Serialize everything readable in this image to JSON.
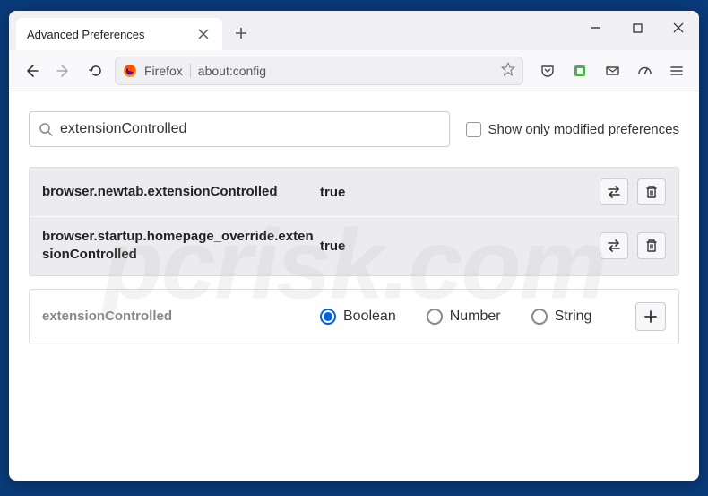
{
  "window": {
    "tab_title": "Advanced Preferences"
  },
  "toolbar": {
    "brand": "Firefox",
    "address": "about:config"
  },
  "search": {
    "value": "extensionControlled",
    "checkbox_label": "Show only modified preferences"
  },
  "prefs": [
    {
      "name": "browser.newtab.extensionControlled",
      "value": "true"
    },
    {
      "name": "browser.startup.homepage_override.extensionControlled",
      "value": "true"
    }
  ],
  "add": {
    "name": "extensionControlled",
    "types": [
      "Boolean",
      "Number",
      "String"
    ],
    "selected": 0
  },
  "watermark": "pcrisk.com"
}
